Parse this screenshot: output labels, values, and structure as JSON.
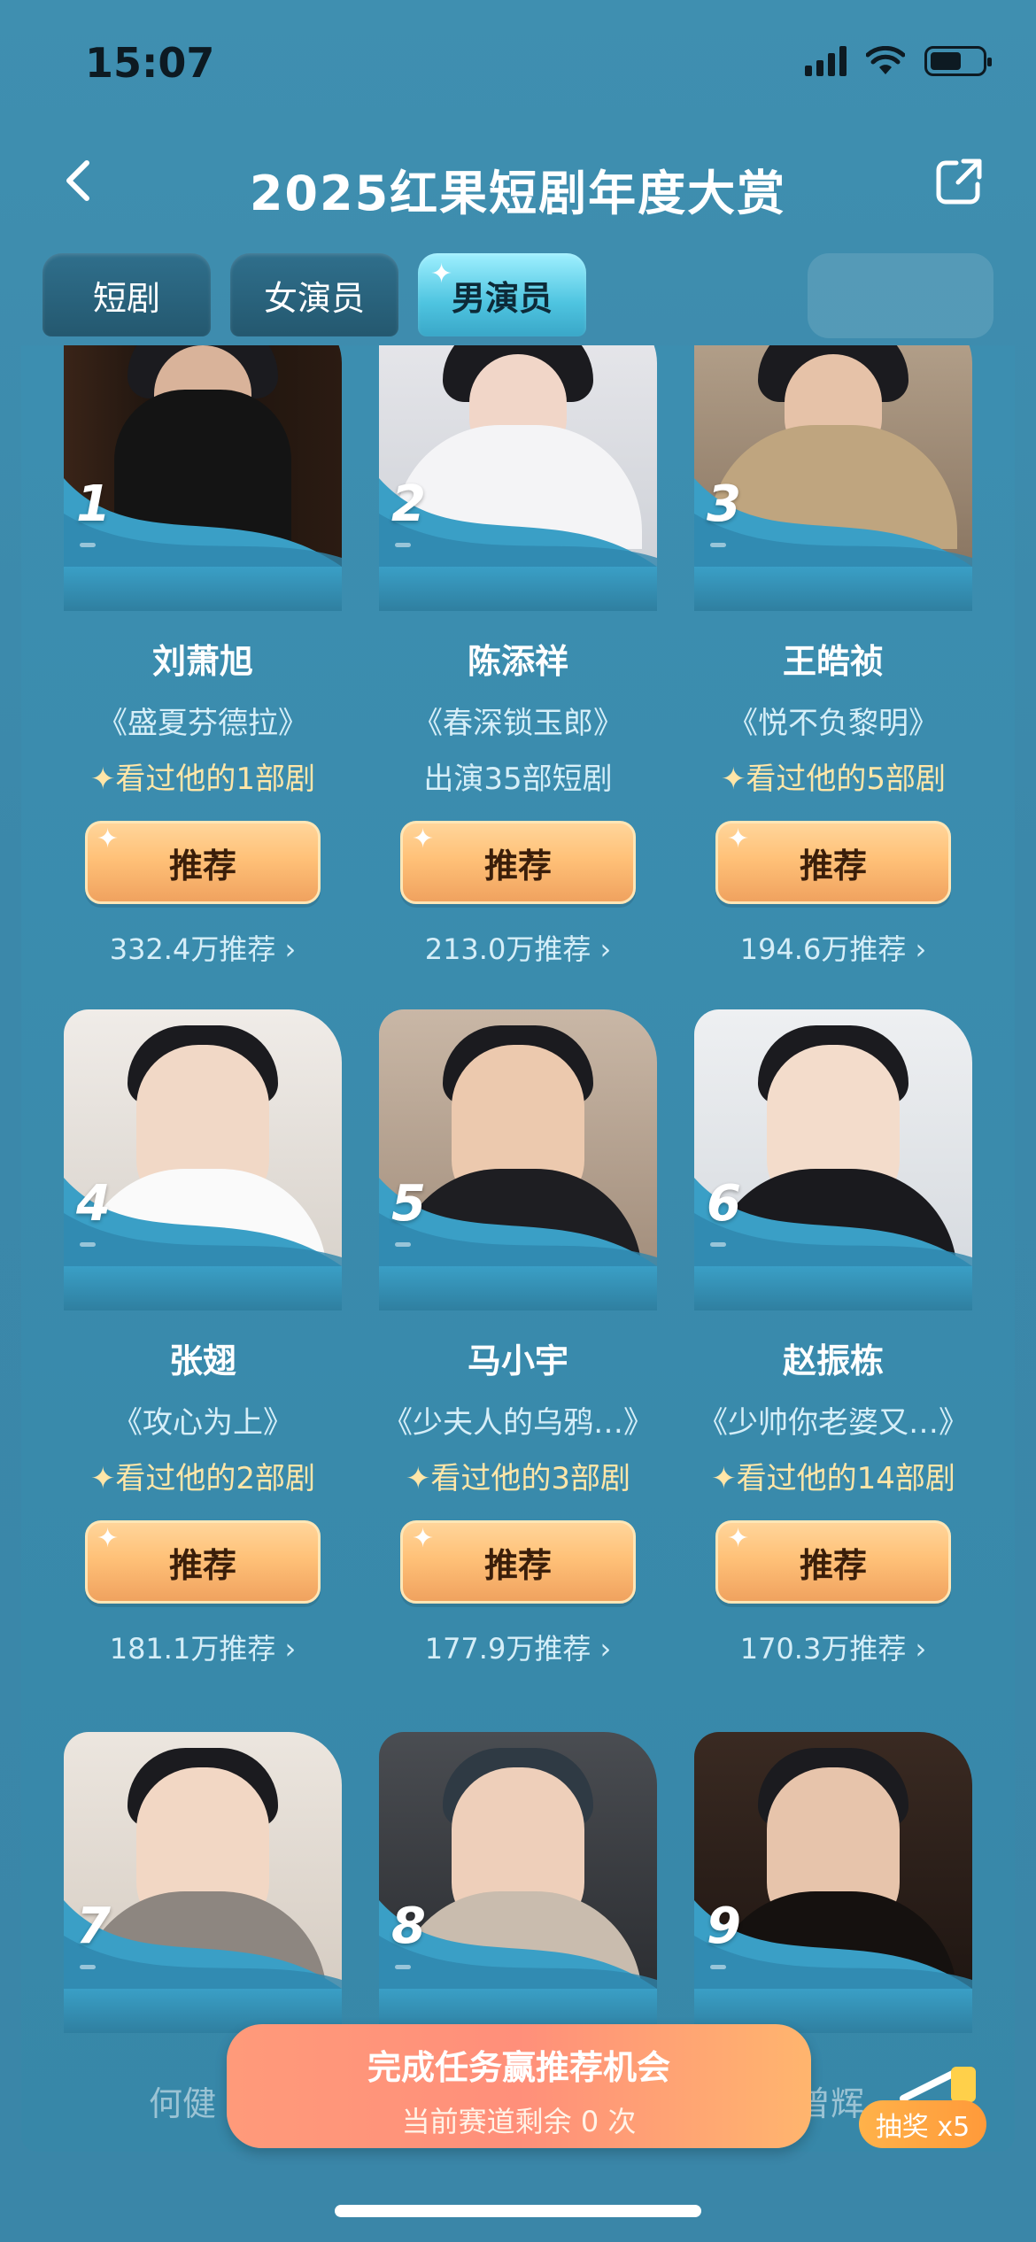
{
  "status": {
    "time": "15:07"
  },
  "header": {
    "title": "2025红果短剧年度大赏"
  },
  "tabs": [
    {
      "label": "短剧",
      "active": false
    },
    {
      "label": "女演员",
      "active": false
    },
    {
      "label": "男演员",
      "active": true
    }
  ],
  "actors": [
    {
      "rank": "1",
      "name": "刘萧旭",
      "drama": "《盛夏芬德拉》",
      "watched": "✦看过他的1部剧",
      "button": "推荐",
      "count": "332.4万推荐 ›"
    },
    {
      "rank": "2",
      "name": "陈添祥",
      "drama": "《春深锁玉郎》",
      "watched": "出演35部短剧",
      "button": "推荐",
      "count": "213.0万推荐 ›"
    },
    {
      "rank": "3",
      "name": "王皓祯",
      "drama": "《悦不负黎明》",
      "watched": "✦看过他的5部剧",
      "button": "推荐",
      "count": "194.6万推荐 ›"
    },
    {
      "rank": "4",
      "name": "张翅",
      "drama": "《攻心为上》",
      "watched": "✦看过他的2部剧",
      "button": "推荐",
      "count": "181.1万推荐 ›"
    },
    {
      "rank": "5",
      "name": "马小宇",
      "drama": "《少夫人的乌鸦…》",
      "watched": "✦看过他的3部剧",
      "button": "推荐",
      "count": "177.9万推荐 ›"
    },
    {
      "rank": "6",
      "name": "赵振栋",
      "drama": "《少帅你老婆又…》",
      "watched": "✦看过他的14部剧",
      "button": "推荐",
      "count": "170.3万推荐 ›"
    },
    {
      "rank": "7",
      "name": "何健",
      "drama": "",
      "watched": "",
      "button": "",
      "count": ""
    },
    {
      "rank": "8",
      "name": "",
      "drama": "",
      "watched": "",
      "button": "",
      "count": ""
    },
    {
      "rank": "9",
      "name": "曾辉",
      "drama": "",
      "watched": "",
      "button": "",
      "count": ""
    }
  ],
  "task_banner": {
    "title": "完成任务赢推荐机会",
    "subtitle": "当前赛道剩余 0 次"
  },
  "lottery": {
    "label": "抽奖 x5"
  },
  "partial_names": {
    "left": "何健",
    "right": "曾辉"
  },
  "colors": {
    "accent": "#3b88aa",
    "button": "#ffc178",
    "banner": "#ff8f7a"
  },
  "icons": {
    "back": "chevron-left-icon",
    "share": "share-icon",
    "signal": "signal-icon",
    "wifi": "wifi-icon",
    "battery": "battery-icon"
  }
}
